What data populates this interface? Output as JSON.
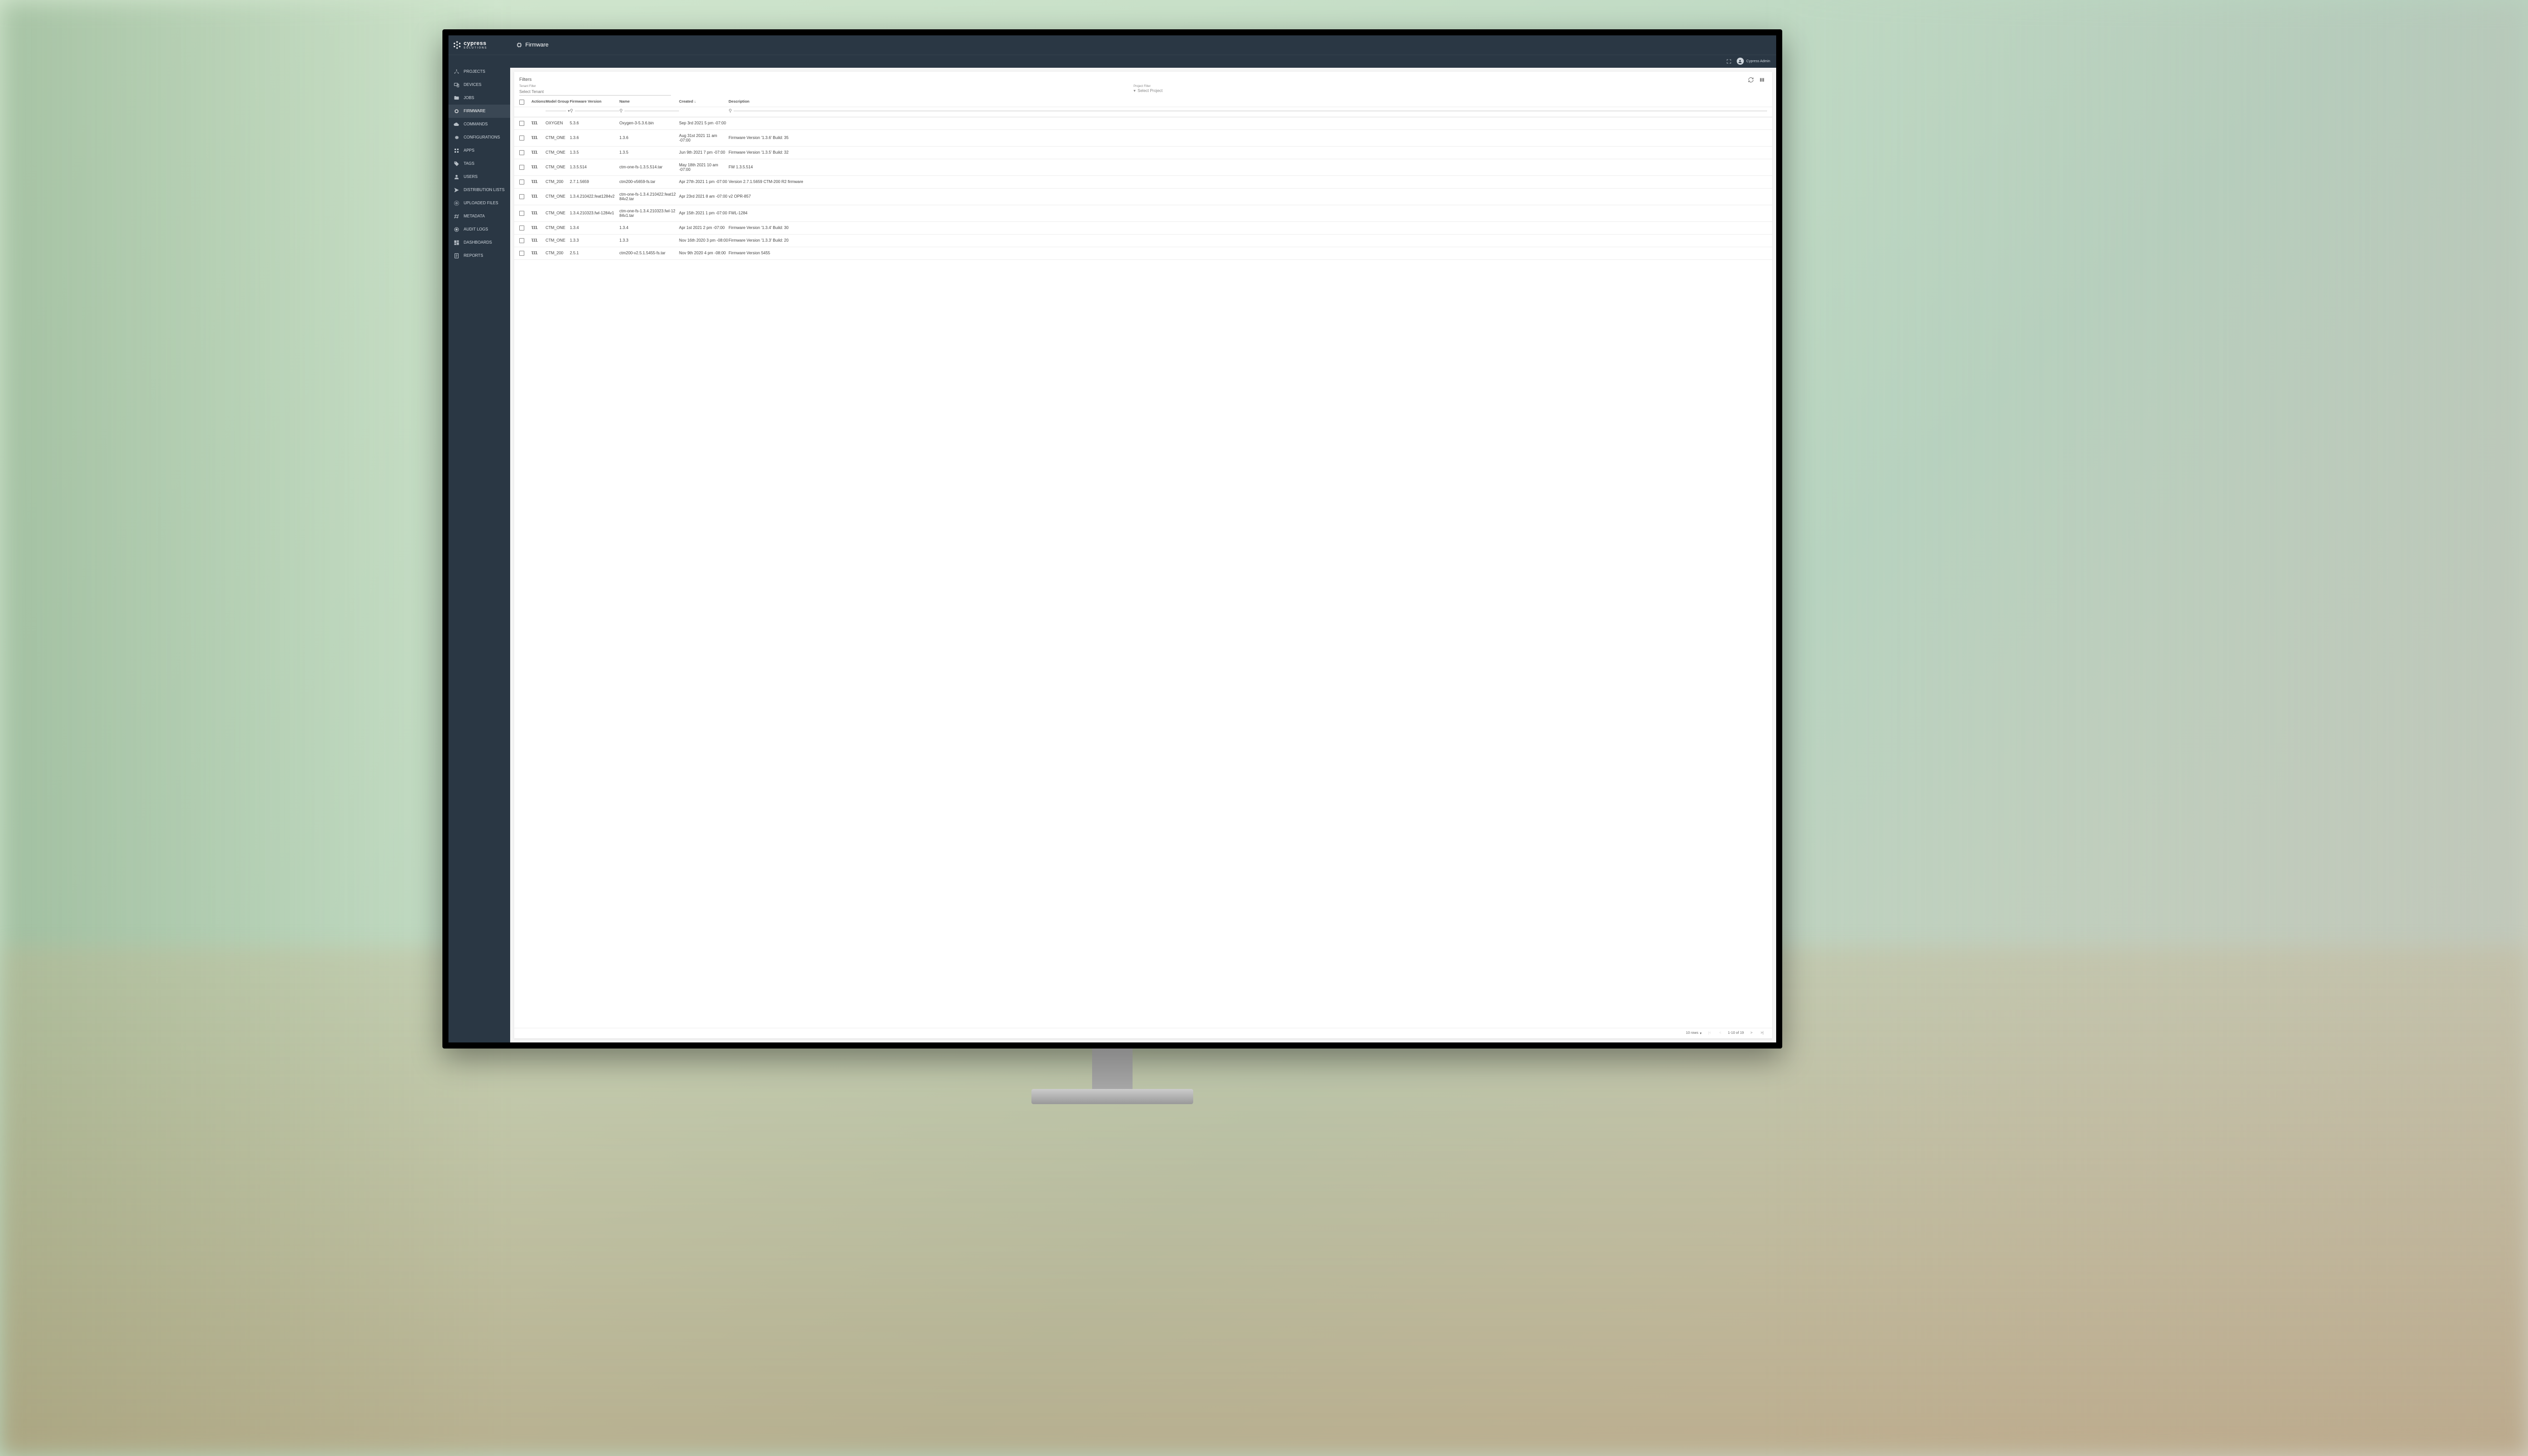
{
  "brand": {
    "name": "cypress",
    "sub": "SOLUTIONS"
  },
  "page_title": "Firmware",
  "user": {
    "name": "Cypress Admin"
  },
  "sidebar": {
    "items": [
      {
        "label": "PROJECTS",
        "icon": "circle-nodes-icon"
      },
      {
        "label": "DEVICES",
        "icon": "devices-icon"
      },
      {
        "label": "JOBS",
        "icon": "folder-icon"
      },
      {
        "label": "FIRMWARE",
        "icon": "chip-icon",
        "active": true
      },
      {
        "label": "COMMANDS",
        "icon": "cloud-icon"
      },
      {
        "label": "CONFIGURATIONS",
        "icon": "gear-icon"
      },
      {
        "label": "APPS",
        "icon": "grid-icon"
      },
      {
        "label": "TAGS",
        "icon": "tag-icon"
      },
      {
        "label": "USERS",
        "icon": "user-icon"
      },
      {
        "label": "DISTRIBUTION LISTS",
        "icon": "send-icon"
      },
      {
        "label": "UPLOADED FILES",
        "icon": "upload-icon"
      },
      {
        "label": "METADATA",
        "icon": "metadata-icon"
      },
      {
        "label": "AUDIT LOGS",
        "icon": "target-icon"
      },
      {
        "label": "DASHBOARDS",
        "icon": "dashboard-icon"
      },
      {
        "label": "REPORTS",
        "icon": "report-icon"
      }
    ]
  },
  "filters": {
    "title": "Filters",
    "tenant_label": "Tenant Filter",
    "tenant_placeholder": "Select Tenant",
    "project_label": "Project Filter",
    "project_placeholder": "Select Project"
  },
  "table": {
    "headers": {
      "actions": "Actions",
      "model_group": "Model Group",
      "firmware_version": "Firmware Version",
      "name": "Name",
      "created": "Created",
      "description": "Description"
    },
    "rows": [
      {
        "model_group": "OXYGEN",
        "firmware_version": "5.3.6",
        "name": "Oxygen-3-5.3.6.bin",
        "created": "Sep 3rd 2021 5 pm -07:00",
        "description": ""
      },
      {
        "model_group": "CTM_ONE",
        "firmware_version": "1.3.6",
        "name": "1.3.6",
        "created": "Aug 31st 2021 11 am -07:00",
        "description": "Firmware Version '1.3.6' Build: 35"
      },
      {
        "model_group": "CTM_ONE",
        "firmware_version": "1.3.5",
        "name": "1.3.5",
        "created": "Jun 9th 2021 7 pm -07:00",
        "description": "Firmware Version '1.3.5' Build: 32"
      },
      {
        "model_group": "CTM_ONE",
        "firmware_version": "1.3.5.514",
        "name": "ctm-one-fs-1.3.5.514.tar",
        "created": "May 18th 2021 10 am -07:00",
        "description": "FW 1.3.5.514"
      },
      {
        "model_group": "CTM_200",
        "firmware_version": "2.7.1.5659",
        "name": "ctm200-v5659-fs.tar",
        "created": "Apr 27th 2021 1 pm -07:00",
        "description": "Version 2.7.1.5659 CTM-200 R2 firmware"
      },
      {
        "model_group": "CTM_ONE",
        "firmware_version": "1.3.4.210422.feat1284v2",
        "name": "ctm-one-fs-1.3.4.210422.feat1284v2.tar",
        "created": "Apr 23rd 2021 8 am -07:00",
        "description": "v2 OPR-857"
      },
      {
        "model_group": "CTM_ONE",
        "firmware_version": "1.3.4.210323.fwl-1284v1",
        "name": "ctm-one-fs-1.3.4.210323.fwl-1284v1.tar",
        "created": "Apr 15th 2021 1 pm -07:00",
        "description": "FWL-1284"
      },
      {
        "model_group": "CTM_ONE",
        "firmware_version": "1.3.4",
        "name": "1.3.4",
        "created": "Apr 1st 2021 2 pm -07:00",
        "description": "Firmware Version '1.3.4' Build: 30"
      },
      {
        "model_group": "CTM_ONE",
        "firmware_version": "1.3.3",
        "name": "1.3.3",
        "created": "Nov 16th 2020 3 pm -08:00",
        "description": "Firmware Version '1.3.3' Build: 20"
      },
      {
        "model_group": "CTM_200",
        "firmware_version": "2.5.1",
        "name": "ctm200-v2.5.1.5455-fs.tar",
        "created": "Nov 9th 2020 4 pm -08:00",
        "description": "Firmware Version 5455"
      }
    ]
  },
  "pagination": {
    "rows_label": "10 rows",
    "range": "1-10 of 19"
  }
}
